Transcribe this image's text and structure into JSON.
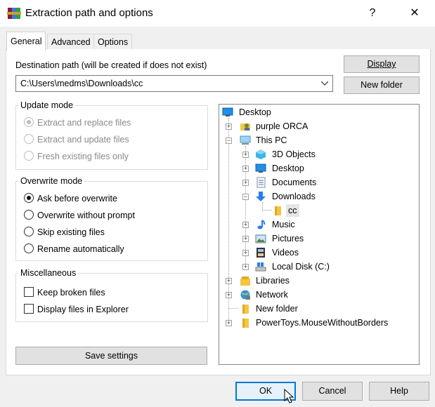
{
  "window": {
    "title": "Extraction path and options",
    "help_glyph": "?",
    "close_glyph": "✕"
  },
  "tabs": [
    "General",
    "Advanced",
    "Options"
  ],
  "destination": {
    "label": "Destination path (will be created if does not exist)",
    "value": "C:\\Users\\medms\\Downloads\\cc"
  },
  "buttons": {
    "display": "Display",
    "new_folder": "New folder",
    "save_settings": "Save settings",
    "ok": "OK",
    "cancel": "Cancel",
    "help": "Help"
  },
  "update_mode": {
    "title": "Update mode",
    "options": [
      "Extract and replace files",
      "Extract and update files",
      "Fresh existing files only"
    ]
  },
  "overwrite_mode": {
    "title": "Overwrite mode",
    "options": [
      "Ask before overwrite",
      "Overwrite without prompt",
      "Skip existing files",
      "Rename automatically"
    ]
  },
  "misc": {
    "title": "Miscellaneous",
    "options": [
      "Keep broken files",
      "Display files in Explorer"
    ]
  },
  "tree": {
    "items": [
      "Desktop",
      "purple ORCA",
      "This PC",
      "3D Objects",
      "Desktop",
      "Documents",
      "Downloads",
      "cc",
      "Music",
      "Pictures",
      "Videos",
      "Local Disk (C:)",
      "Libraries",
      "Network",
      "New folder",
      "PowerToys.MouseWithoutBorders"
    ]
  }
}
